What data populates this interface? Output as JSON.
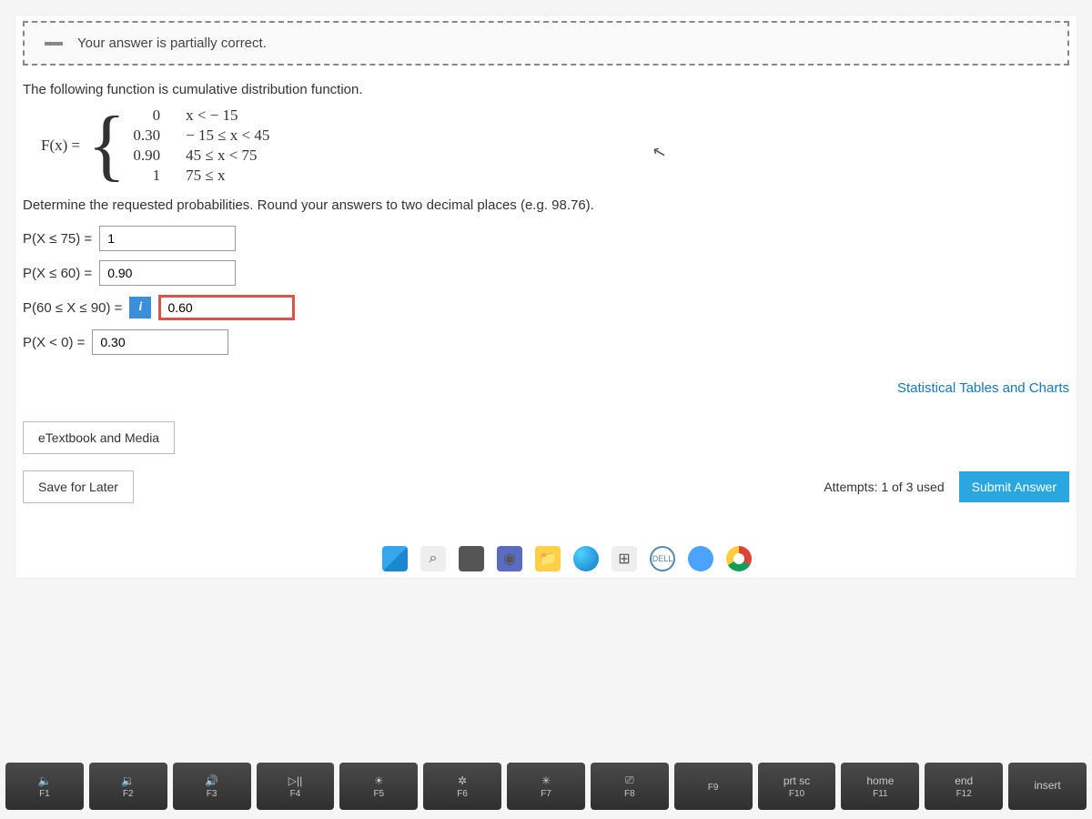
{
  "feedback": {
    "text": "Your answer is partially correct."
  },
  "intro": "The following function is cumulative distribution function.",
  "function": {
    "name": "F(x) =",
    "cases": [
      {
        "value": "0",
        "cond": "x < − 15"
      },
      {
        "value": "0.30",
        "cond": "− 15 ≤ x < 45"
      },
      {
        "value": "0.90",
        "cond": "45 ≤ x < 75"
      },
      {
        "value": "1",
        "cond": "75 ≤ x"
      }
    ]
  },
  "instruction": "Determine the requested probabilities. Round your answers to two decimal places (e.g. 98.76).",
  "problems": [
    {
      "label": "P(X ≤ 75) =",
      "value": "1"
    },
    {
      "label": "P(X ≤ 60) =",
      "value": "0.90"
    },
    {
      "label": "P(60 ≤ X ≤ 90) =",
      "value": "0.60",
      "has_info": true,
      "info_glyph": "i",
      "highlight": true
    },
    {
      "label": "P(X < 0) =",
      "value": "0.30"
    }
  ],
  "links": {
    "stats": "Statistical Tables and Charts"
  },
  "buttons": {
    "etextbook": "eTextbook and Media",
    "save": "Save for Later",
    "submit": "Submit Answer"
  },
  "attempts": "Attempts: 1 of 3 used",
  "taskbar": {
    "search_glyph": "⌕",
    "task_glyph": "▭",
    "cam_glyph": "◉",
    "folder_glyph": "📁",
    "store_glyph": "⊞",
    "dell_label": "DELL"
  },
  "keyboard": [
    {
      "top": "🔈",
      "bottom": "F1"
    },
    {
      "top": "🔉",
      "bottom": "F2"
    },
    {
      "top": "🔊",
      "bottom": "F3"
    },
    {
      "top": "▷||",
      "bottom": "F4"
    },
    {
      "top": "☀",
      "bottom": "F5"
    },
    {
      "top": "✲",
      "bottom": "F6"
    },
    {
      "top": "✳",
      "bottom": "F7"
    },
    {
      "top": "⎚",
      "bottom": "F8"
    },
    {
      "top": "",
      "bottom": "F9"
    },
    {
      "top": "prt sc",
      "bottom": "F10"
    },
    {
      "top": "home",
      "bottom": "F11"
    },
    {
      "top": "end",
      "bottom": "F12"
    },
    {
      "top": "insert",
      "bottom": ""
    }
  ],
  "cursor_glyph": "↖"
}
